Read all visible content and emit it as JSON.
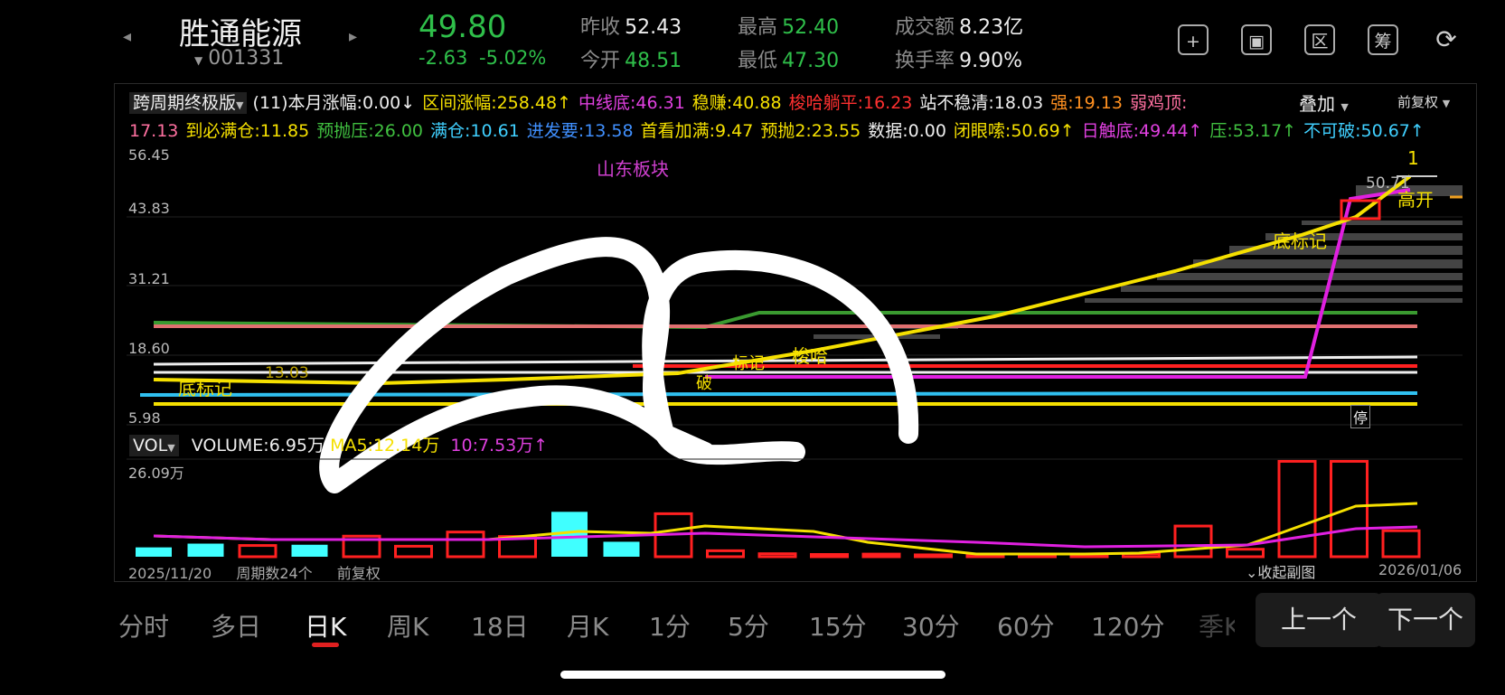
{
  "header": {
    "stock_name": "胜通能源",
    "stock_code": "001331",
    "price": "49.80",
    "change": "-2.63",
    "change_pct": "-5.02%",
    "prev_close_label": "昨收",
    "prev_close": "52.43",
    "open_label": "今开",
    "open": "48.51",
    "high_label": "最高",
    "high": "52.40",
    "low_label": "最低",
    "low": "47.30",
    "turnover_label": "成交额",
    "turnover": "8.23亿",
    "turnover_rate_label": "换手率",
    "turnover_rate": "9.90%",
    "toolbar": [
      {
        "icon": "plus-icon",
        "glyph": "+"
      },
      {
        "icon": "screen-icon",
        "glyph": "▣"
      },
      {
        "icon": "range-icon",
        "glyph": "区"
      },
      {
        "icon": "chip-icon",
        "glyph": "筹"
      },
      {
        "icon": "rotate-icon",
        "glyph": "⟳"
      }
    ]
  },
  "indicator_bar": {
    "name": "跨周期终极版",
    "period": "(11)",
    "overlay_label": "叠加",
    "adjust_label": "前复权",
    "row1": [
      {
        "text": "本月涨幅:0.00↓",
        "color": "#eeeeee"
      },
      {
        "text": "区间涨幅:258.48↑",
        "color": "#f5e000"
      },
      {
        "text": "中线底:46.31",
        "color": "#e040e0"
      },
      {
        "text": "稳赚:40.88",
        "color": "#f5e000"
      },
      {
        "text": "梭哈躺平:16.23",
        "color": "#ff3030"
      },
      {
        "text": "站不稳清:18.03",
        "color": "#eeeeee"
      },
      {
        "text": "强:19.13",
        "color": "#ff9020"
      },
      {
        "text": "弱鸡顶:",
        "color": "#ff70a0"
      }
    ],
    "row2": [
      {
        "text": "17.13",
        "color": "#ff70a0"
      },
      {
        "text": "到必满仓:11.85",
        "color": "#f5e000"
      },
      {
        "text": "预抛压:26.00",
        "color": "#40c040"
      },
      {
        "text": "满仓:10.61",
        "color": "#40d0ff"
      },
      {
        "text": "进发要:13.58",
        "color": "#4090ff"
      },
      {
        "text": "首看加满:9.47",
        "color": "#f5e000"
      },
      {
        "text": "预抛2:23.55",
        "color": "#f5e000"
      },
      {
        "text": "数据:0.00",
        "color": "#eeeeee"
      },
      {
        "text": "闭眼嗦:50.69↑",
        "color": "#f5e000"
      },
      {
        "text": "日触底:49.44↑",
        "color": "#e040e0"
      },
      {
        "text": "压:53.17↑",
        "color": "#40c040"
      },
      {
        "text": "不可破:50.67↑",
        "color": "#40d0ff"
      }
    ]
  },
  "main_chart": {
    "y_ticks": [
      "56.45",
      "43.83",
      "31.21",
      "18.60",
      "5.98"
    ],
    "annotations": {
      "sector": "山东板块",
      "label_1": "1",
      "label_price": "50.71",
      "gap_up": "高开",
      "bottom_mark_right": "底标记",
      "bottom_mark_left": "底标记",
      "low_value": "13.03",
      "sell_mark": "梭哈",
      "mark2": "标记",
      "halt": "停",
      "break": "破"
    }
  },
  "volume_chart": {
    "name": "VOL",
    "volume_label": "VOLUME:6.95万",
    "ma5_label": "MA5:12.14万",
    "ma10_label": "10:7.53万↑",
    "y_max": "26.09万",
    "start_date": "2025/11/20",
    "periods": "周期数24个",
    "adjust": "前复权",
    "collapse": "收起副图",
    "end_date": "2026/01/06"
  },
  "chart_data": {
    "type": "bar",
    "title": "",
    "ylabel": "",
    "ylim": [
      0,
      26.09
    ],
    "values": [
      2.5,
      3.5,
      3,
      3.2,
      5.5,
      2.8,
      6.6,
      5.4,
      12,
      4,
      11.5,
      1.6,
      0.8,
      0.6,
      0.7,
      0.5,
      0.6,
      0.6,
      0.6,
      0.8,
      8.2,
      2.0,
      25.5,
      25.5,
      6.95
    ],
    "colors": [
      "cyan",
      "cyan",
      "red",
      "cyan",
      "red",
      "red",
      "red",
      "red",
      "cyan",
      "cyan",
      "red",
      "red",
      "red",
      "red",
      "red",
      "red",
      "red",
      "red",
      "red",
      "red",
      "red",
      "red",
      "red",
      "red",
      "red"
    ]
  },
  "periods_bar": {
    "tabs": [
      "分时",
      "多日",
      "日K",
      "周K",
      "18日",
      "月K",
      "1分",
      "5分",
      "15分",
      "30分",
      "60分",
      "120分",
      "季K"
    ],
    "active": "日K",
    "prev_label": "上一个",
    "next_label": "下一个"
  }
}
